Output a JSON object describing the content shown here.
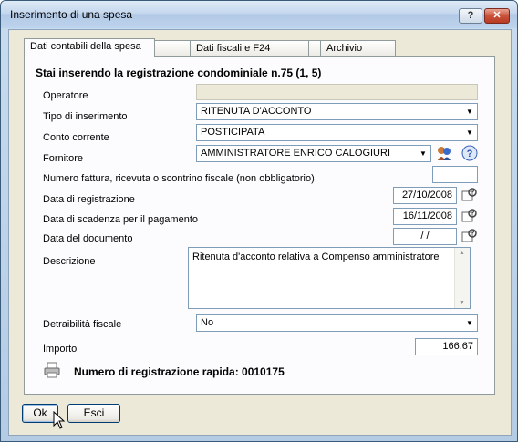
{
  "window": {
    "title": "Inserimento di una spesa",
    "help_label": "?",
    "close_label": "✕"
  },
  "tabs": [
    {
      "label": "Dati contabili della spesa"
    },
    {
      "label": ""
    },
    {
      "label": "Dati fiscali e F24"
    },
    {
      "label": ""
    },
    {
      "label": "Archivio digitale"
    }
  ],
  "form": {
    "heading": "Stai inserendo la registrazione condominiale n.75  (1, 5)",
    "operatore_label": "Operatore",
    "operatore_value": "",
    "tipo_label": "Tipo di inserimento",
    "tipo_value": "RITENUTA D'ACCONTO",
    "conto_label": "Conto corrente",
    "conto_value": "POSTICIPATA",
    "fornitore_label": "Fornitore",
    "fornitore_value": "AMMINISTRATORE ENRICO CALOGIURI",
    "fattura_label": "Numero fattura, ricevuta o scontrino fiscale (non obbligatorio)",
    "fattura_value": "",
    "data_reg_label": "Data di registrazione",
    "data_reg_value": "27/10/2008",
    "scadenza_label": "Data di scadenza per il pagamento",
    "scadenza_value": "16/11/2008",
    "data_doc_label": "Data del documento",
    "data_doc_value": " /  /",
    "descrizione_label": "Descrizione",
    "descrizione_value": "Ritenuta d'acconto relativa a Compenso amministratore",
    "detraibilita_label": "Detraibilità fiscale",
    "detraibilita_value": "No",
    "importo_label": "Importo",
    "importo_value": "166,67",
    "registrazione_rapida": "Numero di registrazione rapida: 0010175"
  },
  "buttons": {
    "ok_label": "Ok",
    "esci_label": "Esci"
  }
}
